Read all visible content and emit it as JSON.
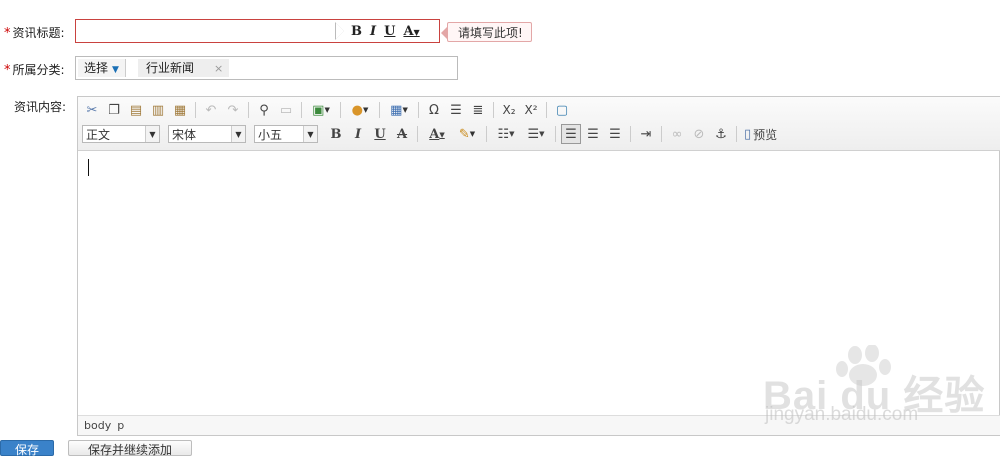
{
  "form": {
    "title_label": "资讯标题:",
    "title_value": "",
    "title_format": {
      "bold": "B",
      "italic": "I",
      "underline": "U",
      "color": "A"
    },
    "title_error": "请填写此项!",
    "category_label": "所属分类:",
    "category_select": "选择",
    "category_tag": "行业新闻",
    "category_remove": "×",
    "content_label": "资讯内容:",
    "required_mark": "*"
  },
  "editor": {
    "toolbar_row1": {
      "special_char": "Ω",
      "subscript": "X₂",
      "superscript": "X²"
    },
    "toolbar_row2": {
      "paragraph_format": "正文",
      "font_family": "宋体",
      "font_size": "小五",
      "bold": "B",
      "italic": "I",
      "underline": "U",
      "strike": "A",
      "font_color": "A",
      "preview": "预览"
    },
    "status_path": [
      "body",
      "p"
    ]
  },
  "watermark": {
    "brand": "Bai du 经验",
    "url": "jingyan.baidu.com"
  },
  "buttons": {
    "save": "保存",
    "save_continue": "保存并继续添加"
  },
  "colors": {
    "error_border": "#c9423f",
    "primary_button": "#3a82c9"
  }
}
